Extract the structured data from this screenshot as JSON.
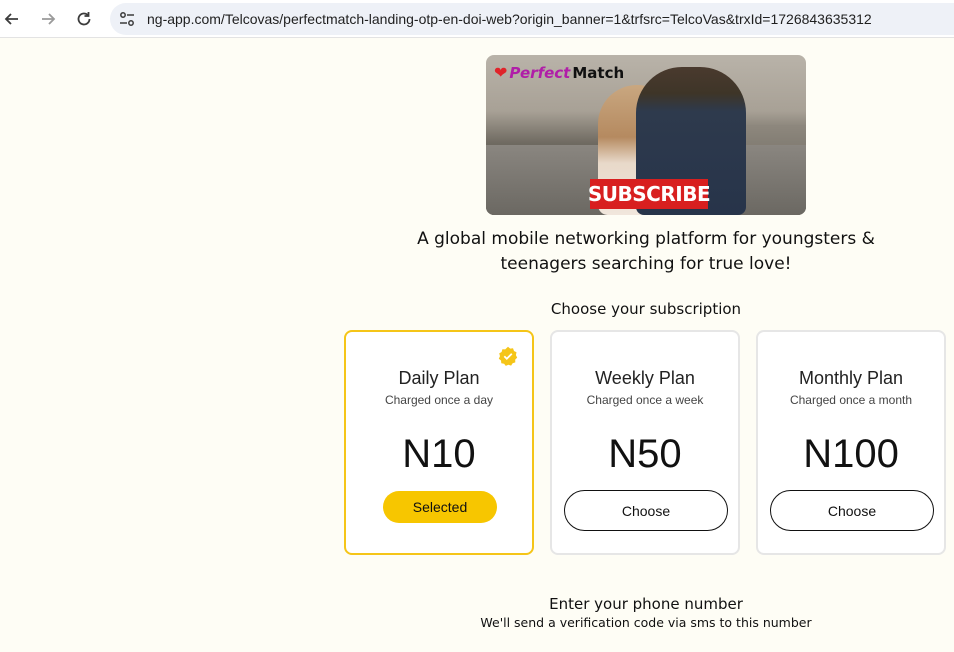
{
  "browser": {
    "url": "ng-app.com/Telcovas/perfectmatch-landing-otp-en-doi-web?origin_banner=1&trfsrc=TelcoVas&trxId=1726843635312"
  },
  "banner": {
    "logo_part1": "Perfect",
    "logo_part2": "Match",
    "subscribe_label": "SUBSCRIBE"
  },
  "tagline_line1": "A global mobile networking platform for youngsters &",
  "tagline_line2": "teenagers searching for true love!",
  "choose_title": "Choose your subscription",
  "plans": [
    {
      "name": "Daily Plan",
      "desc": "Charged once a day",
      "price": "N10",
      "button": "Selected",
      "selected": true
    },
    {
      "name": "Weekly Plan",
      "desc": "Charged once a week",
      "price": "N50",
      "button": "Choose",
      "selected": false
    },
    {
      "name": "Monthly Plan",
      "desc": "Charged once a month",
      "price": "N100",
      "button": "Choose",
      "selected": false
    }
  ],
  "phone_title": "Enter your phone number",
  "phone_sub": "We'll send a verification code via sms to this number",
  "colors": {
    "accent": "#f7c600",
    "selected_border": "#f5c518",
    "subscribe_red": "#d81f1f"
  }
}
